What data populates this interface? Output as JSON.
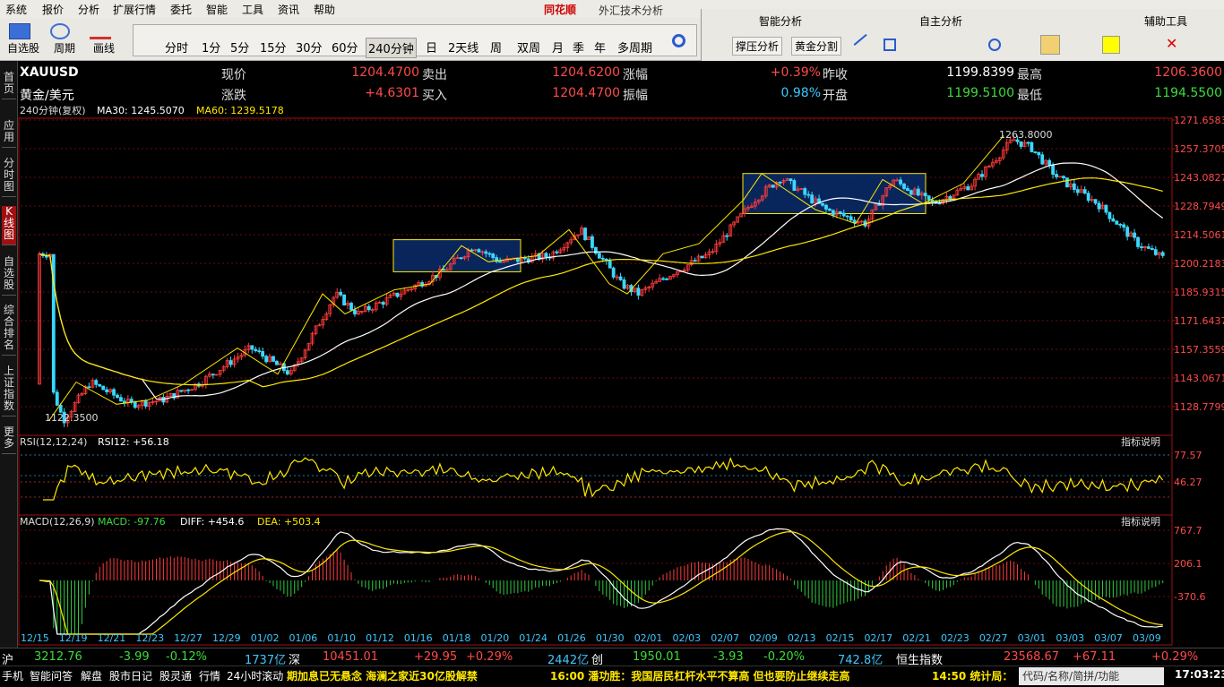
{
  "menu": {
    "items": [
      "系统",
      "报价",
      "分析",
      "扩展行情",
      "委托",
      "智能",
      "工具",
      "资讯",
      "帮助"
    ],
    "brand": "同花顺",
    "subtitle": "外汇技术分析"
  },
  "toolbar": {
    "tools": [
      "自选股",
      "周期",
      "画线"
    ],
    "periods": [
      "分时",
      "1分",
      "5分",
      "15分",
      "30分",
      "60分",
      "240分钟",
      "日",
      "2天线",
      "周",
      "双周",
      "月",
      "季",
      "年",
      "多周期"
    ],
    "selected_period": "240分钟"
  },
  "right_panel": {
    "smart": "智能分析",
    "self": "自主分析",
    "aux": "辅助工具",
    "buttons": [
      "撑压分析",
      "黄金分割"
    ]
  },
  "sidetabs": [
    "首页",
    "应用",
    "分时图",
    "K线图",
    "自选股",
    "综合排名",
    "上证指数",
    "更多"
  ],
  "quote": {
    "symbol": "XAUUSD",
    "name": "黄金/美元",
    "labels": [
      "现价",
      "涨跌",
      "卖出",
      "买入",
      "涨幅",
      "振幅",
      "昨收",
      "开盘",
      "最高",
      "最低"
    ],
    "price": "1204.4700",
    "change": "+4.6301",
    "sell": "1204.6200",
    "buy": "1204.4700",
    "pct": "+0.39%",
    "amp": "0.98%",
    "prev": "1199.8399",
    "open": "1199.5100",
    "high": "1206.3600",
    "low": "1194.5500"
  },
  "chart_header": {
    "period": "240分钟(复权)",
    "ma30": "MA30: 1245.5070",
    "ma60": "MA60: 1239.5178"
  },
  "price_axis": [
    "1271.6583",
    "1257.3705",
    "1243.0827",
    "1228.7949",
    "1214.5061",
    "1200.2183",
    "1185.9315",
    "1171.6437",
    "1157.3559",
    "1143.0671",
    "1128.7799"
  ],
  "annotations": {
    "high": "1263.8000",
    "low": "1122.3500"
  },
  "rsi": {
    "label": "RSI(12,12,24)",
    "value": "RSI12: +56.18",
    "axis": [
      "77.57",
      "46.27"
    ],
    "help": "指标说明"
  },
  "macd": {
    "label": "MACD(12,26,9)",
    "macd": "MACD: -97.76",
    "diff": "DIFF: +454.6",
    "dea": "DEA: +503.4",
    "axis": [
      "767.7",
      "206.1",
      "-370.6"
    ],
    "help": "指标说明"
  },
  "dates": [
    "12/15",
    "12/19",
    "12/21",
    "12/23",
    "12/27",
    "12/29",
    "01/02",
    "01/06",
    "01/10",
    "01/12",
    "01/16",
    "01/18",
    "01/20",
    "01/24",
    "01/26",
    "01/30",
    "02/01",
    "02/03",
    "02/07",
    "02/09",
    "02/13",
    "02/15",
    "02/17",
    "02/21",
    "02/23",
    "02/27",
    "03/01",
    "03/03",
    "03/07",
    "03/09"
  ],
  "status": {
    "sh": "沪",
    "sh_val": "3212.76",
    "sh_chg": "-3.99",
    "sh_pct": "-0.12%",
    "sh_amt": "1737亿",
    "sz": "深",
    "sz_val": "10451.01",
    "sz_chg": "+29.95",
    "sz_pct": "+0.29%",
    "sz_amt": "2442亿",
    "cy": "创",
    "cy_val": "1950.01",
    "cy_chg": "-3.93",
    "cy_pct": "-0.20%",
    "cy_amt": "742.8亿",
    "hs": "恒生指数",
    "hs_val": "23568.67",
    "hs_chg": "+67.11",
    "hs_pct": "+0.29%"
  },
  "ticker": {
    "tabs": [
      "手机",
      "智能问答",
      "解盘",
      "股市日记",
      "股灵通",
      "行情",
      "24小时滚动"
    ],
    "news1": "期加息已无悬念 海澜之家近30亿股解禁",
    "news2": "16:00 潘功胜：我国居民杠杆水平不算高 但也要防止继续走高",
    "news3": "14:50 统计局：",
    "search": "代码/名称/简拼/功能",
    "time": "17:03:23"
  }
}
